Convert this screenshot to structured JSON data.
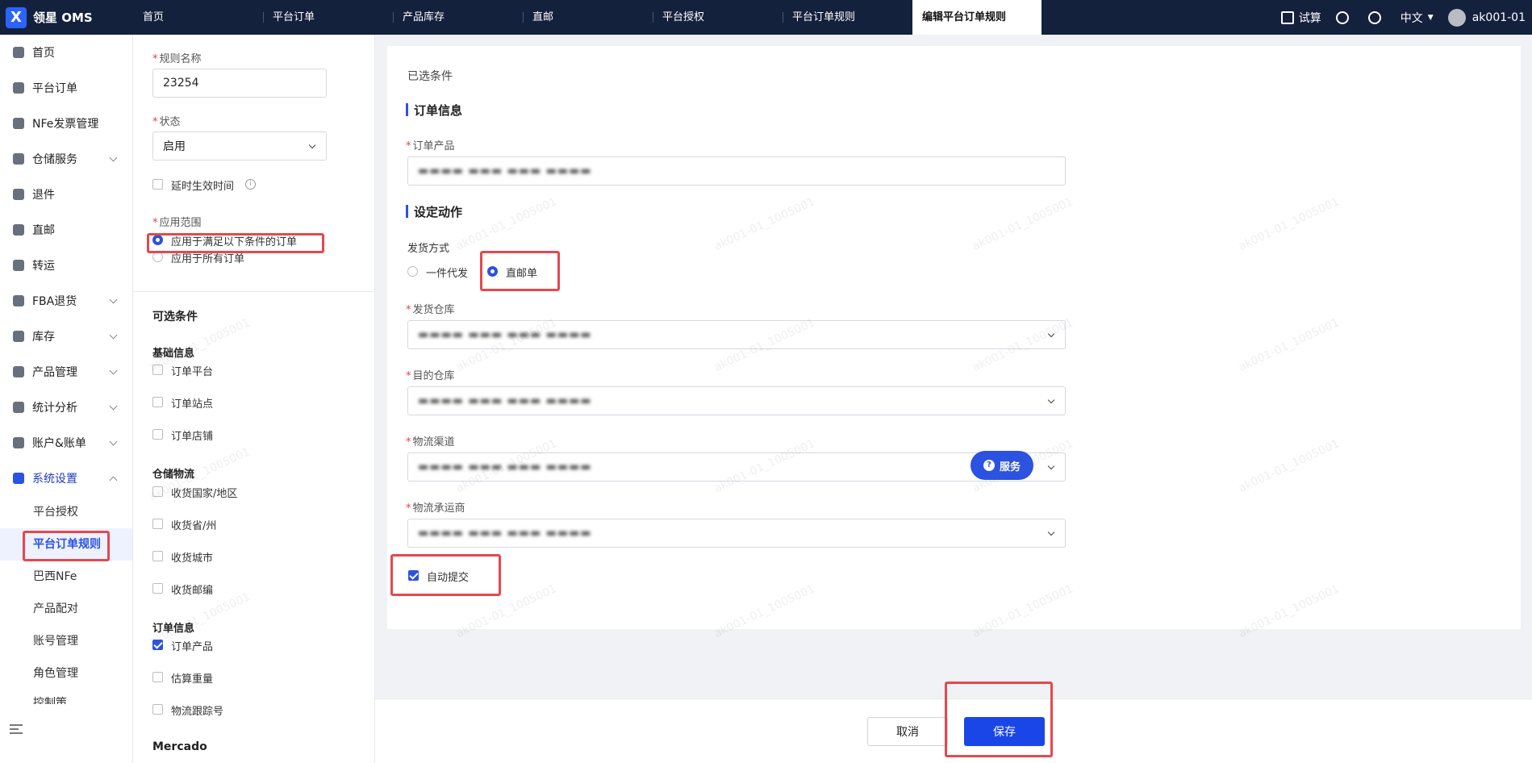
{
  "app": {
    "logo_text": "领星 OMS",
    "logo_letter": "X"
  },
  "tabs": [
    "首页",
    "平台订单",
    "产品库存",
    "直邮",
    "平台授权",
    "平台订单规则",
    "编辑平台订单规则"
  ],
  "topbar": {
    "trial": "试算",
    "language": "中文",
    "user": "ak001-01"
  },
  "sidebar": {
    "items": [
      {
        "label": "首页"
      },
      {
        "label": "平台订单"
      },
      {
        "label": "NFe发票管理"
      },
      {
        "label": "仓储服务"
      },
      {
        "label": "退件"
      },
      {
        "label": "直邮"
      },
      {
        "label": "转运"
      },
      {
        "label": "FBA退货"
      },
      {
        "label": "库存"
      },
      {
        "label": "产品管理"
      },
      {
        "label": "统计分析"
      },
      {
        "label": "账户&账单"
      },
      {
        "label": "系统设置"
      }
    ],
    "sub_items": [
      "平台授权",
      "平台订单规则",
      "巴西NFe",
      "产品配对",
      "账号管理",
      "角色管理",
      "控制策"
    ]
  },
  "form": {
    "rule_name_label": "规则名称",
    "rule_name_value": "23254",
    "status_label": "状态",
    "status_value": "启用",
    "delay_label": "延时生效时间",
    "scope_label": "应用范围",
    "scope_opt1": "应用于满足以下条件的订单",
    "scope_opt2": "应用于所有订单",
    "optional_title": "可选条件",
    "group_basic": "基础信息",
    "basic_items": [
      "订单平台",
      "订单站点",
      "订单店铺"
    ],
    "group_logistics": "仓储物流",
    "logistics_items": [
      "收货国家/地区",
      "收货省/州",
      "收货城市",
      "收货邮编"
    ],
    "group_order": "订单信息",
    "order_items": [
      "订单产品",
      "估算重量",
      "物流跟踪号"
    ],
    "group_mercado": "Mercado"
  },
  "main": {
    "selected_title": "已选条件",
    "order_info_title": "订单信息",
    "order_product_label": "订单产品",
    "order_product_value": "(blurred)",
    "action_title": "设定动作",
    "ship_method_label": "发货方式",
    "ship_opt1": "一件代发",
    "ship_opt2": "直邮单",
    "ship_wh_label": "发货仓库",
    "ship_wh_value": "(blurred)",
    "dest_wh_label": "目的仓库",
    "dest_wh_value": "(blurred)",
    "channel_label": "物流渠道",
    "channel_value": "(blurred)",
    "carrier_label": "物流承运商",
    "carrier_value": "(blurred)",
    "auto_submit": "自动提交",
    "service_btn": "服务",
    "cancel": "取消",
    "save": "保存"
  },
  "watermark": "ak001-01_1005001"
}
